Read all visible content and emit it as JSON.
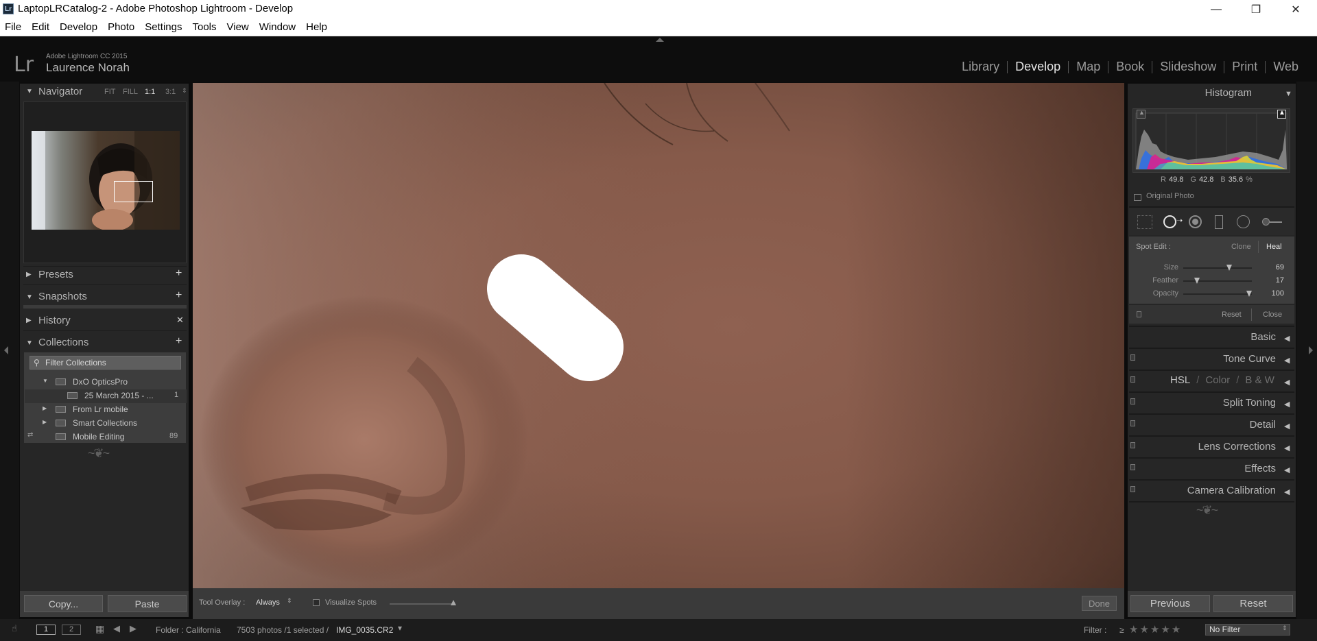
{
  "window": {
    "title": "LaptopLRCatalog-2 - Adobe Photoshop Lightroom - Develop",
    "app_icon": "Lr",
    "controls": {
      "minimize": "—",
      "restore": "❐",
      "close": "✕"
    }
  },
  "menu": [
    "File",
    "Edit",
    "Develop",
    "Photo",
    "Settings",
    "Tools",
    "View",
    "Window",
    "Help"
  ],
  "identity": {
    "logo": "Lr",
    "product": "Adobe Lightroom CC 2015",
    "name": "Laurence Norah"
  },
  "modules": [
    "Library",
    "Develop",
    "Map",
    "Book",
    "Slideshow",
    "Print",
    "Web"
  ],
  "active_module": "Develop",
  "left": {
    "navigator": {
      "title": "Navigator",
      "options": [
        "FIT",
        "FILL",
        "1:1",
        "3:1"
      ],
      "active": "1:1"
    },
    "panels": {
      "presets": "Presets",
      "snapshots": "Snapshots",
      "history": "History",
      "collections": "Collections"
    },
    "filter_placeholder": "Filter Collections",
    "collections": [
      {
        "name": "DxO OpticsPro",
        "count": ""
      },
      {
        "name": "25 March 2015 - ...",
        "count": "1"
      },
      {
        "name": "From Lr mobile",
        "count": ""
      },
      {
        "name": "Smart Collections",
        "count": ""
      },
      {
        "name": "Mobile Editing",
        "count": "89"
      }
    ],
    "copy_button": "Copy...",
    "paste_button": "Paste"
  },
  "toolbar": {
    "overlay_label": "Tool Overlay :",
    "overlay_value": "Always",
    "visualize_label": "Visualize Spots",
    "done_button": "Done"
  },
  "right": {
    "histogram": {
      "title": "Histogram",
      "rgb": {
        "r_label": "R",
        "r": "49.8",
        "g_label": "G",
        "g": "42.8",
        "b_label": "B",
        "b": "35.6",
        "unit": "%"
      },
      "original_photo": "Original Photo"
    },
    "spot": {
      "label": "Spot Edit :",
      "clone": "Clone",
      "heal": "Heal",
      "sliders": [
        {
          "name": "Size",
          "value": "69",
          "fraction": 0.69
        },
        {
          "name": "Feather",
          "value": "17",
          "fraction": 0.17
        },
        {
          "name": "Opacity",
          "value": "100",
          "fraction": 1.0
        }
      ],
      "reset": "Reset",
      "close": "Close"
    },
    "panels": {
      "basic": "Basic",
      "tone_curve": "Tone Curve",
      "hsl": "HSL",
      "slash": "/",
      "color": "Color",
      "bw": "B & W",
      "split_toning": "Split Toning",
      "detail": "Detail",
      "lens_corrections": "Lens Corrections",
      "effects": "Effects",
      "camera_calibration": "Camera Calibration"
    },
    "previous_button": "Previous",
    "reset_button": "Reset"
  },
  "filmstrip": {
    "page1": "1",
    "page2": "2",
    "folder": "Folder : California",
    "photos": "7503 photos /1 selected /",
    "filename": "IMG_0035.CR2",
    "filter_label": "Filter :",
    "ge": "≥",
    "stars": "★★★★★",
    "filter_value": "No Filter"
  }
}
